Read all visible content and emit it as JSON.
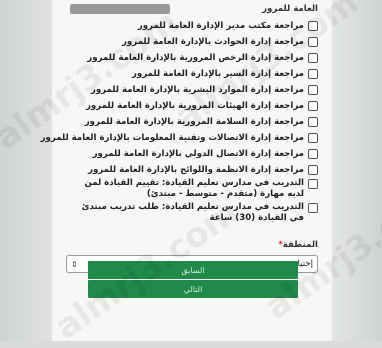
{
  "header": {
    "partial_line": "العامة للمرور"
  },
  "items": [
    {
      "label": "مراجعة مكتب مدير الإدارة العامة للمرور",
      "checked": false
    },
    {
      "label": "مراجعة إدارة الحوادث بالإدارة العامة للمرور",
      "checked": false
    },
    {
      "label": "مراجعة إدارة الرخص المرورية بالإدارة العامة للمرور",
      "checked": false
    },
    {
      "label": "مراجعة إدارة السير بالإدارة العامة للمرور",
      "checked": false
    },
    {
      "label": "مراجعة إدارة الموارد البشرية بالإدارة العامة للمرور",
      "checked": false
    },
    {
      "label": "مراجعة إدارة الهيئات المرورية بالإدارة العامة للمرور",
      "checked": false
    },
    {
      "label": "مراجعة إدارة السلامة المرورية بالإدارة العامة للمرور",
      "checked": false
    },
    {
      "label": "مراجعة إدارة الاتصالات وتقنية المعلومات بالإدارة العامة للمرور",
      "checked": false
    },
    {
      "label": "مراجعة إدارة الاتصال الدولي بالإدارة العامة للمرور",
      "checked": false
    },
    {
      "label": "مراجعة إدارة الانظمة واللوائح بالإدارة العامة للمرور",
      "checked": false
    }
  ],
  "long_items": [
    {
      "label": "التدريب في مدارس تعليم القيادة: تقييم القيادة لمن لديه مهارة (متقدم - متوسط - مبتدئ)",
      "checked": false
    },
    {
      "label": "التدريب في مدارس تعليم القيادة: طلب تدريب مبتدئ في القيادة (30) ساعة",
      "checked": false
    }
  ],
  "region": {
    "label": "المنطقة",
    "required_mark": "*",
    "selected": "إختيار"
  },
  "buttons": {
    "prev": "السابق",
    "next": "التالي"
  },
  "watermark": "almrj3.com",
  "colors": {
    "button_bg": "#1f8a4a",
    "button_text": "#cfe9d7",
    "required": "#d33333"
  }
}
